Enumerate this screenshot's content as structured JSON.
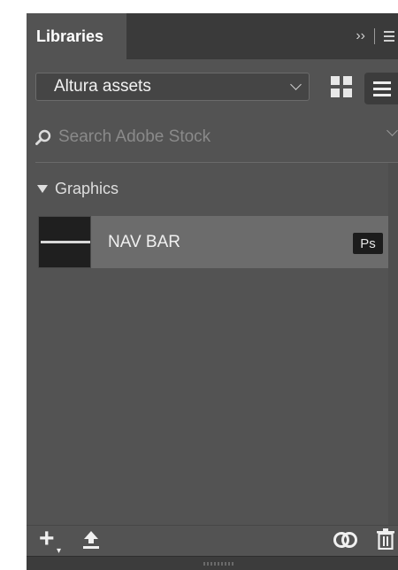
{
  "panel": {
    "tab_title": "Libraries",
    "controls": {
      "expand_icon": "double-chevron-right-icon",
      "expand_glyph": "››",
      "menu_icon": "hamburger-menu-icon"
    }
  },
  "library_select": {
    "value": "Altura assets",
    "options_icon": "chevron-down-icon"
  },
  "view_toggle": {
    "grid_icon": "grid-view-icon",
    "list_icon": "list-view-icon",
    "selected": "list"
  },
  "search": {
    "placeholder": "Search Adobe Stock",
    "icon": "search-icon"
  },
  "groups": [
    {
      "label": "Graphics",
      "expanded": true,
      "items": [
        {
          "name": "NAV BAR",
          "badge": "Ps"
        }
      ]
    }
  ],
  "footer": {
    "add_icon": "plus-icon",
    "upload_icon": "upload-icon",
    "sync_icon": "creative-cloud-icon",
    "trash_icon": "trash-icon"
  },
  "colors": {
    "panel_bg": "#535353",
    "tab_bar_bg": "#3a3a3a",
    "row_bg": "#6c6c6c",
    "badge_bg": "#1c1c1c"
  }
}
